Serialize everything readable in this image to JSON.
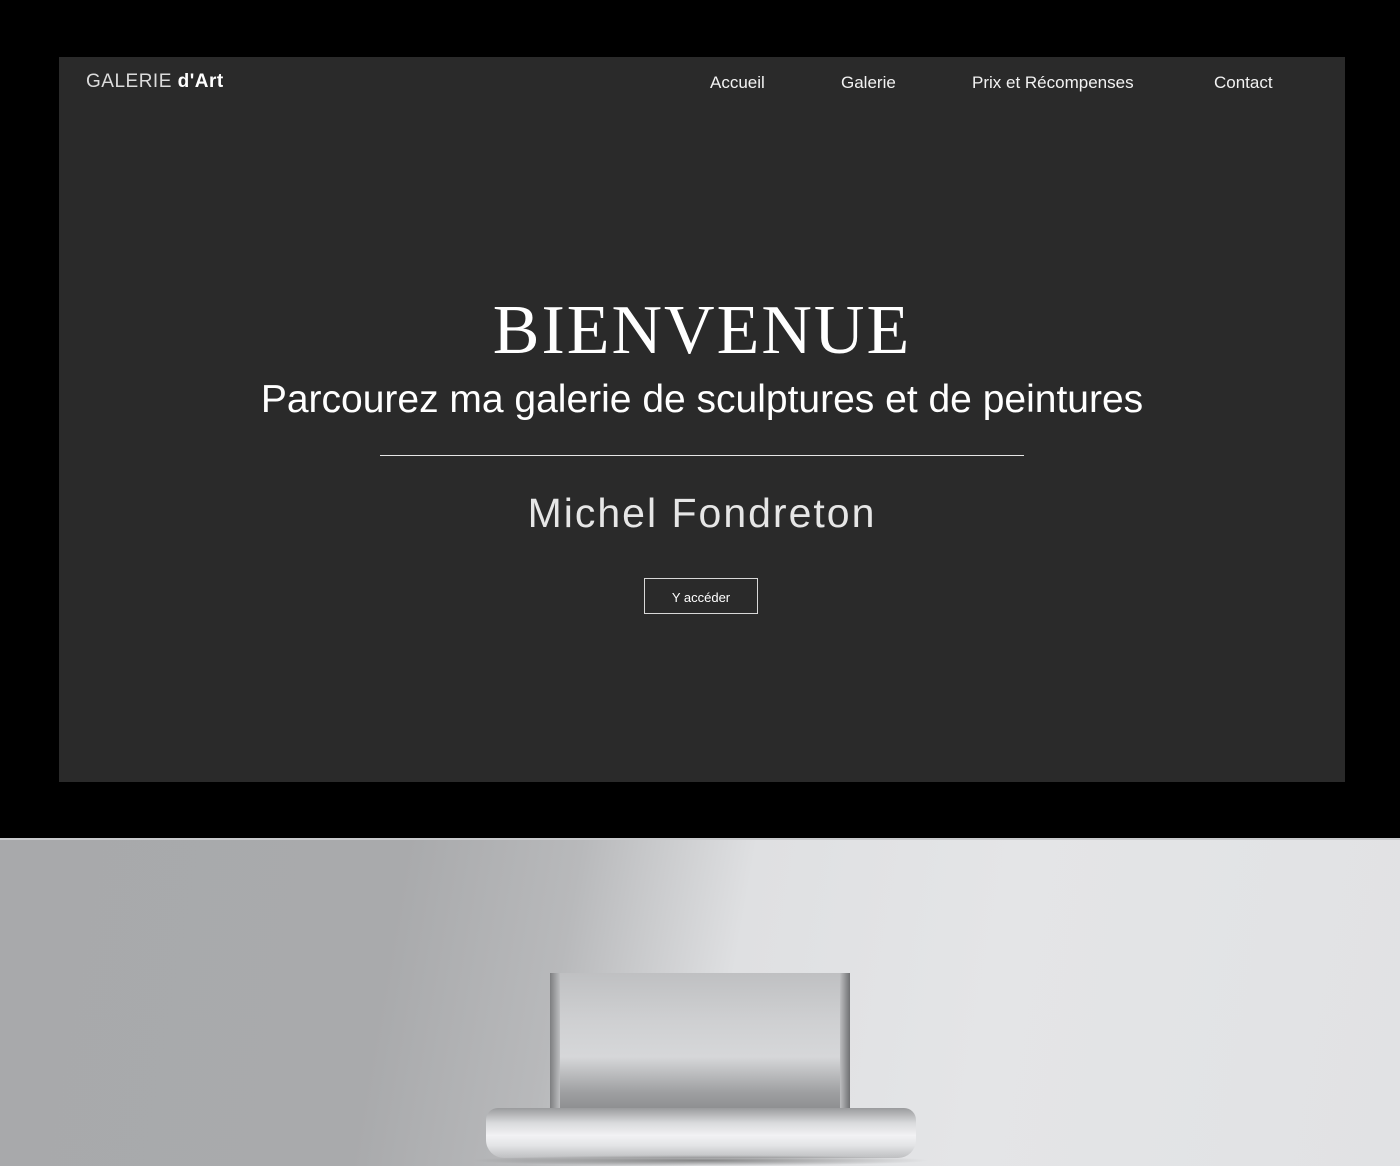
{
  "brand": {
    "prefix": "GALERIE",
    "suffix": "d'Art"
  },
  "nav": {
    "items": [
      {
        "label": "Accueil"
      },
      {
        "label": "Galerie"
      },
      {
        "label": "Prix et Récompenses"
      },
      {
        "label": "Contact"
      }
    ]
  },
  "hero": {
    "title": "BIENVENUE",
    "subtitle": "Parcourez ma galerie de sculptures et de peintures",
    "artist_name": "Michel Fondreton",
    "cta_label": "Y accéder"
  },
  "colors": {
    "screen_background": "#2a2a2a",
    "text": "#ffffff",
    "bezel": "#000000",
    "chassis": "#dfe0e2"
  }
}
